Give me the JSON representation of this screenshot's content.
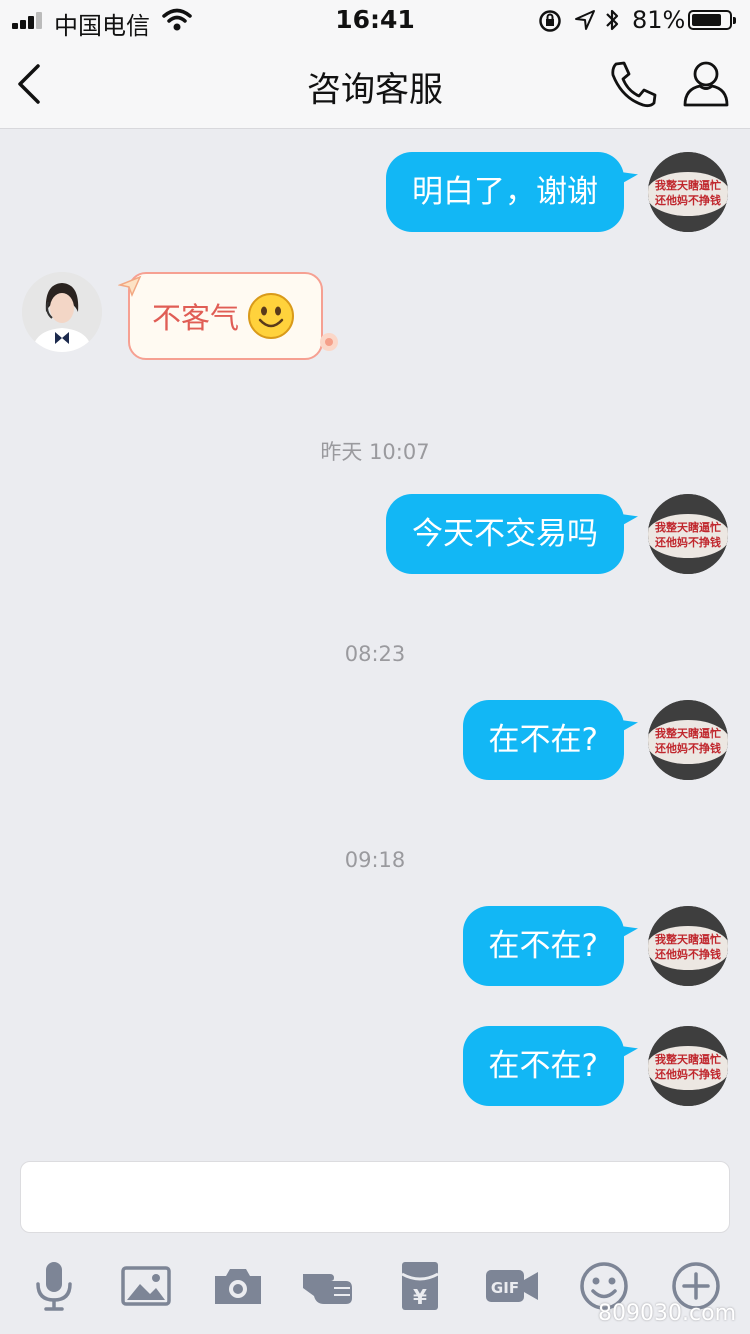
{
  "status_bar": {
    "carrier": "中国电信",
    "time": "16:41",
    "battery_percent": "81%",
    "battery_level": 0.81
  },
  "nav": {
    "title": "咨询客服"
  },
  "messages": [
    {
      "from": "me",
      "text": "明白了，谢谢"
    },
    {
      "from": "agent",
      "text": "不客气"
    },
    {
      "from": "me",
      "text": "今天不交易吗"
    },
    {
      "from": "me",
      "text": "在不在?"
    },
    {
      "from": "me",
      "text": "在不在?"
    },
    {
      "from": "me",
      "text": "在不在?"
    }
  ],
  "timestamps": [
    "昨天 10:07",
    "08:23",
    "09:18"
  ],
  "user_avatar_text": [
    "我整天瞎逼忙",
    "还他妈不挣钱"
  ],
  "input": {
    "value": "",
    "placeholder": ""
  },
  "toolbar": [
    "microphone-icon",
    "image-icon",
    "camera-icon",
    "poke-hand-icon",
    "red-packet-icon",
    "gif-icon",
    "emoji-icon",
    "plus-icon"
  ],
  "watermark": "809030.com",
  "colors": {
    "bubble_out": "#12b7f5",
    "background": "#ebecf0",
    "agent_text": "#e05d55",
    "icon_gray": "#7d8596"
  }
}
